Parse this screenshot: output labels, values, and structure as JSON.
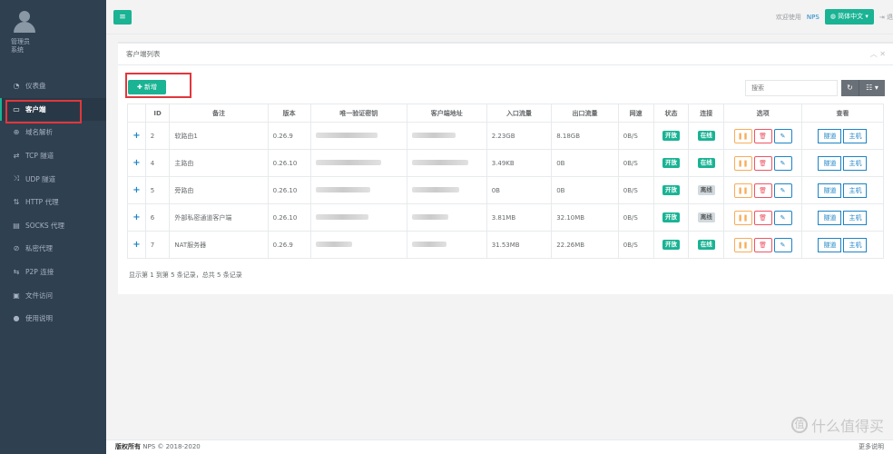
{
  "profile": {
    "role_line1": "管理员",
    "role_line2": "系统"
  },
  "nav": [
    {
      "icon": "dashboard-icon",
      "glyph": "◔",
      "label": "仪表盘"
    },
    {
      "icon": "monitor-icon",
      "glyph": "▭",
      "label": "客户端"
    },
    {
      "icon": "globe-icon",
      "glyph": "⊕",
      "label": "域名解析"
    },
    {
      "icon": "tcp-arrows-icon",
      "glyph": "⇄",
      "label": "TCP 隧道"
    },
    {
      "icon": "udp-shuffle-icon",
      "glyph": "⤨",
      "label": "UDP 隧道"
    },
    {
      "icon": "http-arrows-icon",
      "glyph": "⇅",
      "label": "HTTP 代理"
    },
    {
      "icon": "socks-icon",
      "glyph": "▤",
      "label": "SOCKS 代理"
    },
    {
      "icon": "eye-slash-icon",
      "glyph": "⊘",
      "label": "私密代理"
    },
    {
      "icon": "p2p-icon",
      "glyph": "⇆",
      "label": "P2P 连接"
    },
    {
      "icon": "briefcase-icon",
      "glyph": "▣",
      "label": "文件访问"
    },
    {
      "icon": "bulb-icon",
      "glyph": "●",
      "label": "使用说明"
    }
  ],
  "topbar": {
    "welcome": "欢迎使用",
    "nps": "NPS",
    "language": "简体中文",
    "logout": "退"
  },
  "panel": {
    "title": "客户端列表",
    "add_label": "新增",
    "search_placeholder": "搜索"
  },
  "table": {
    "headers": [
      "",
      "ID",
      "备注",
      "版本",
      "唯一验证密钥",
      "客户端地址",
      "入口流量",
      "出口流量",
      "网速",
      "状态",
      "连接",
      "选项",
      "查看"
    ],
    "rows": [
      {
        "id": "2",
        "remark": "软路由1",
        "version": "0.26.9",
        "in": "2.23GB",
        "out": "8.18GB",
        "speed": "0B/S",
        "status": "开放",
        "conn": "在线",
        "conn_on": true
      },
      {
        "id": "4",
        "remark": "主路由",
        "version": "0.26.10",
        "in": "3.49KB",
        "out": "0B",
        "speed": "0B/S",
        "status": "开放",
        "conn": "在线",
        "conn_on": true
      },
      {
        "id": "5",
        "remark": "旁路由",
        "version": "0.26.10",
        "in": "0B",
        "out": "0B",
        "speed": "0B/S",
        "status": "开放",
        "conn": "离线",
        "conn_on": false
      },
      {
        "id": "6",
        "remark": "外部私密通道客户端",
        "version": "0.26.10",
        "in": "3.81MB",
        "out": "32.10MB",
        "speed": "0B/S",
        "status": "开放",
        "conn": "离线",
        "conn_on": false
      },
      {
        "id": "7",
        "remark": "NAT服务器",
        "version": "0.26.9",
        "in": "31.53MB",
        "out": "22.26MB",
        "speed": "0B/S",
        "status": "开放",
        "conn": "在线",
        "conn_on": true
      }
    ],
    "view_tunnel": "隧道",
    "view_host": "主机"
  },
  "summary": "显示第 1 到第 5 条记录，总共 5 条记录",
  "footer": {
    "copyright_label": "版权所有",
    "copyright": "NPS © 2018-2020",
    "more": "更多说明"
  },
  "watermark": "什么值得买",
  "colors": {
    "accent": "#1ab394",
    "sidebar": "#2f4050",
    "link": "#1c84c6",
    "warn": "#f8ac59",
    "danger": "#ed5565"
  }
}
